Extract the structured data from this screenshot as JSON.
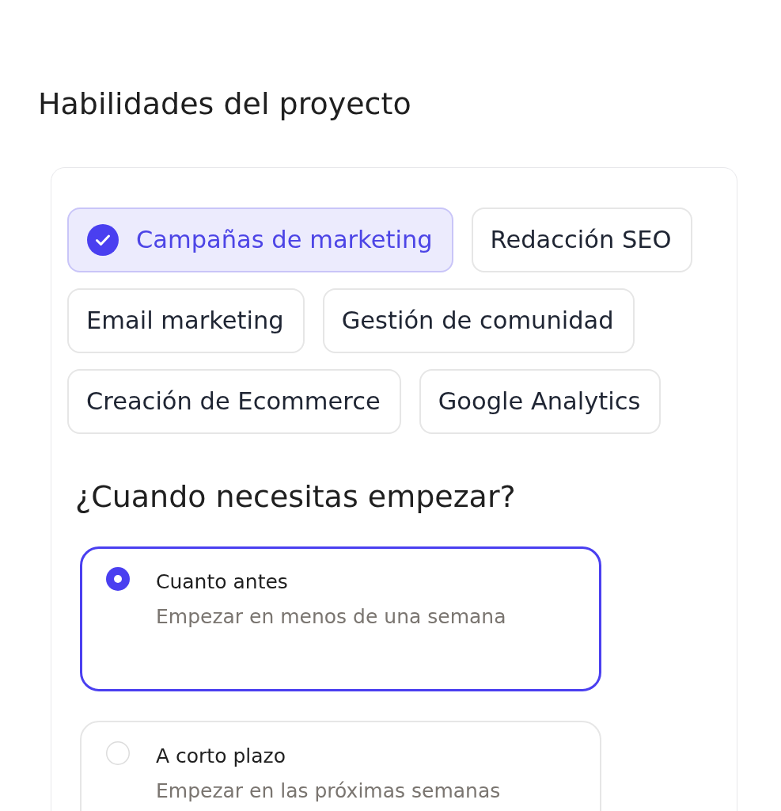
{
  "title": "Habilidades del proyecto",
  "skills": [
    {
      "label": "Campañas de marketing",
      "selected": true
    },
    {
      "label": "Redacción SEO",
      "selected": false
    },
    {
      "label": "Email marketing",
      "selected": false
    },
    {
      "label": "Gestión de comunidad",
      "selected": false
    },
    {
      "label": "Creación de Ecommerce",
      "selected": false
    },
    {
      "label": "Google Analytics",
      "selected": false
    }
  ],
  "start_question": {
    "heading": "¿Cuando necesitas empezar?",
    "options": [
      {
        "title": "Cuanto antes",
        "description": "Empezar en menos de una semana",
        "selected": true
      },
      {
        "title": "A corto plazo",
        "description": "Empezar en las próximas semanas",
        "selected": false
      }
    ]
  }
}
